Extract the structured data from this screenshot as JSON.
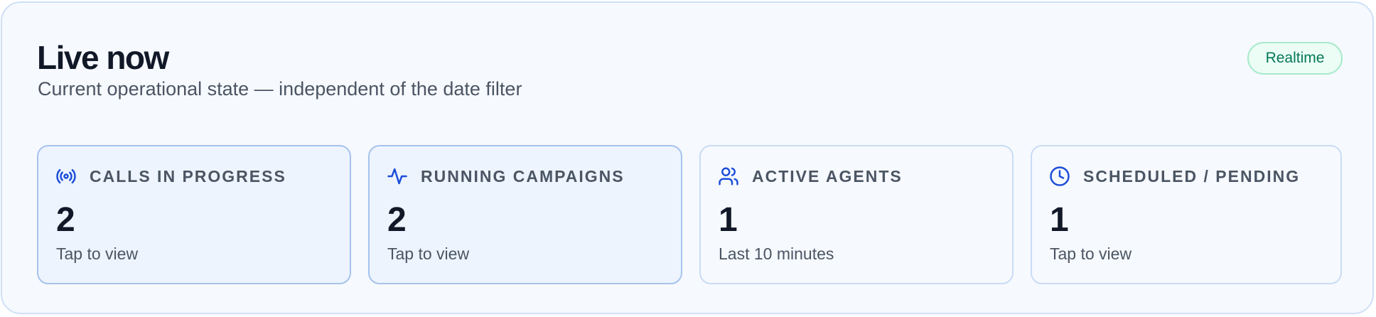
{
  "header": {
    "title": "Live now",
    "subtitle": "Current operational state — independent of the date filter",
    "badge": "Realtime"
  },
  "colors": {
    "accent": "#1d4ed8",
    "badge_text": "#047857",
    "badge_bg": "#ecfdf5"
  },
  "cards": [
    {
      "icon": "broadcast-icon",
      "label": "CALLS IN PROGRESS",
      "value": "2",
      "caption": "Tap to view"
    },
    {
      "icon": "activity-icon",
      "label": "RUNNING CAMPAIGNS",
      "value": "2",
      "caption": "Tap to view"
    },
    {
      "icon": "users-icon",
      "label": "ACTIVE AGENTS",
      "value": "1",
      "caption": "Last 10 minutes"
    },
    {
      "icon": "clock-icon",
      "label": "SCHEDULED / PENDING",
      "value": "1",
      "caption": "Tap to view"
    }
  ]
}
